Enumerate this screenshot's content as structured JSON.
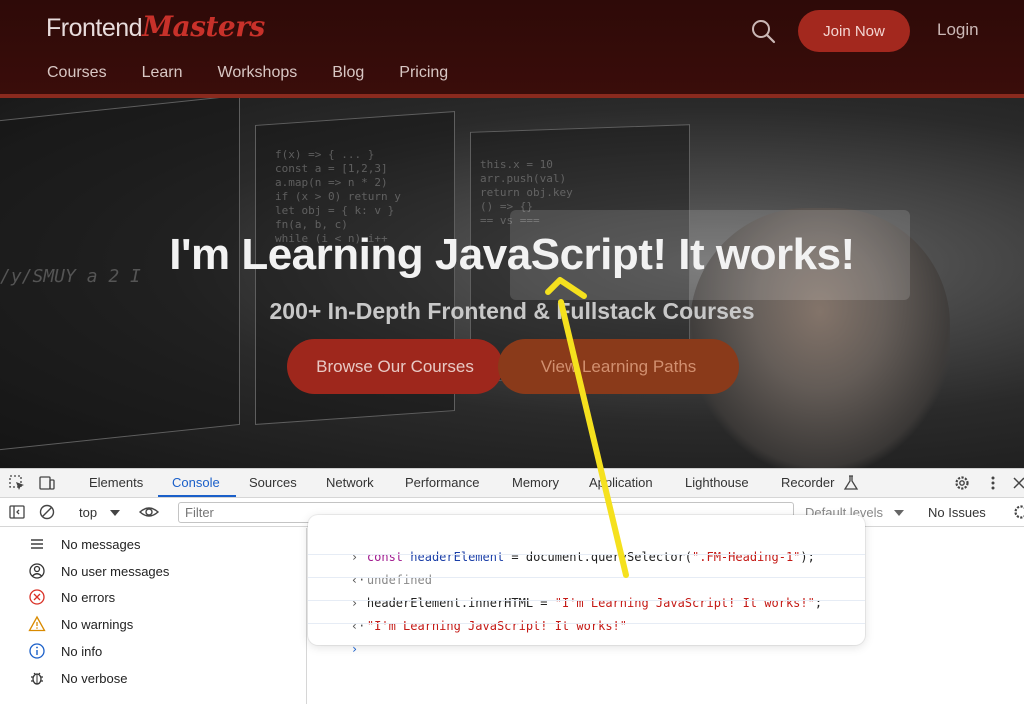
{
  "header": {
    "logo_frontend": "Frontend",
    "logo_masters": "Masters",
    "join_label": "Join Now",
    "login_label": "Login",
    "nav": [
      "Courses",
      "Learn",
      "Workshops",
      "Blog",
      "Pricing"
    ]
  },
  "hero": {
    "title": "I'm Learning JavaScript! It works!",
    "subtitle": "200+ In-Depth Frontend & Fullstack Courses",
    "browse_label": "Browse Our Courses",
    "paths_label": "View Learning Paths",
    "graffiti": "/y/SMUY a 2 I"
  },
  "devtools": {
    "tabs": [
      "Elements",
      "Console",
      "Sources",
      "Network",
      "Performance",
      "Memory",
      "Application",
      "Lighthouse",
      "Recorder"
    ],
    "active_tab": "Console",
    "context": "top",
    "filter_placeholder": "Filter",
    "levels_label": "Default levels",
    "issues_label": "No Issues",
    "sidebar": [
      {
        "label": "No messages",
        "icon": "list-icon"
      },
      {
        "label": "No user messages",
        "icon": "user-icon"
      },
      {
        "label": "No errors",
        "icon": "error-icon"
      },
      {
        "label": "No warnings",
        "icon": "warning-icon"
      },
      {
        "label": "No info",
        "icon": "info-icon"
      },
      {
        "label": "No verbose",
        "icon": "bug-icon"
      }
    ]
  },
  "console": {
    "line1": {
      "kw": "const",
      "var": "headerElement",
      "op": " = document.querySelector(",
      "str": "\".FM-Heading-1\"",
      "end": ");"
    },
    "result1": "undefined",
    "line2": {
      "lhs": "headerElement.innerHTML = ",
      "str": "\"I'm Learning JavaScript! It works!\"",
      "end": ";"
    },
    "result2": "\"I'm Learning JavaScript! It works!\""
  },
  "colors": {
    "brand_red": "#a3281e",
    "devtools_active": "#1a5fc9",
    "arrow_yellow": "#f5e11e"
  }
}
